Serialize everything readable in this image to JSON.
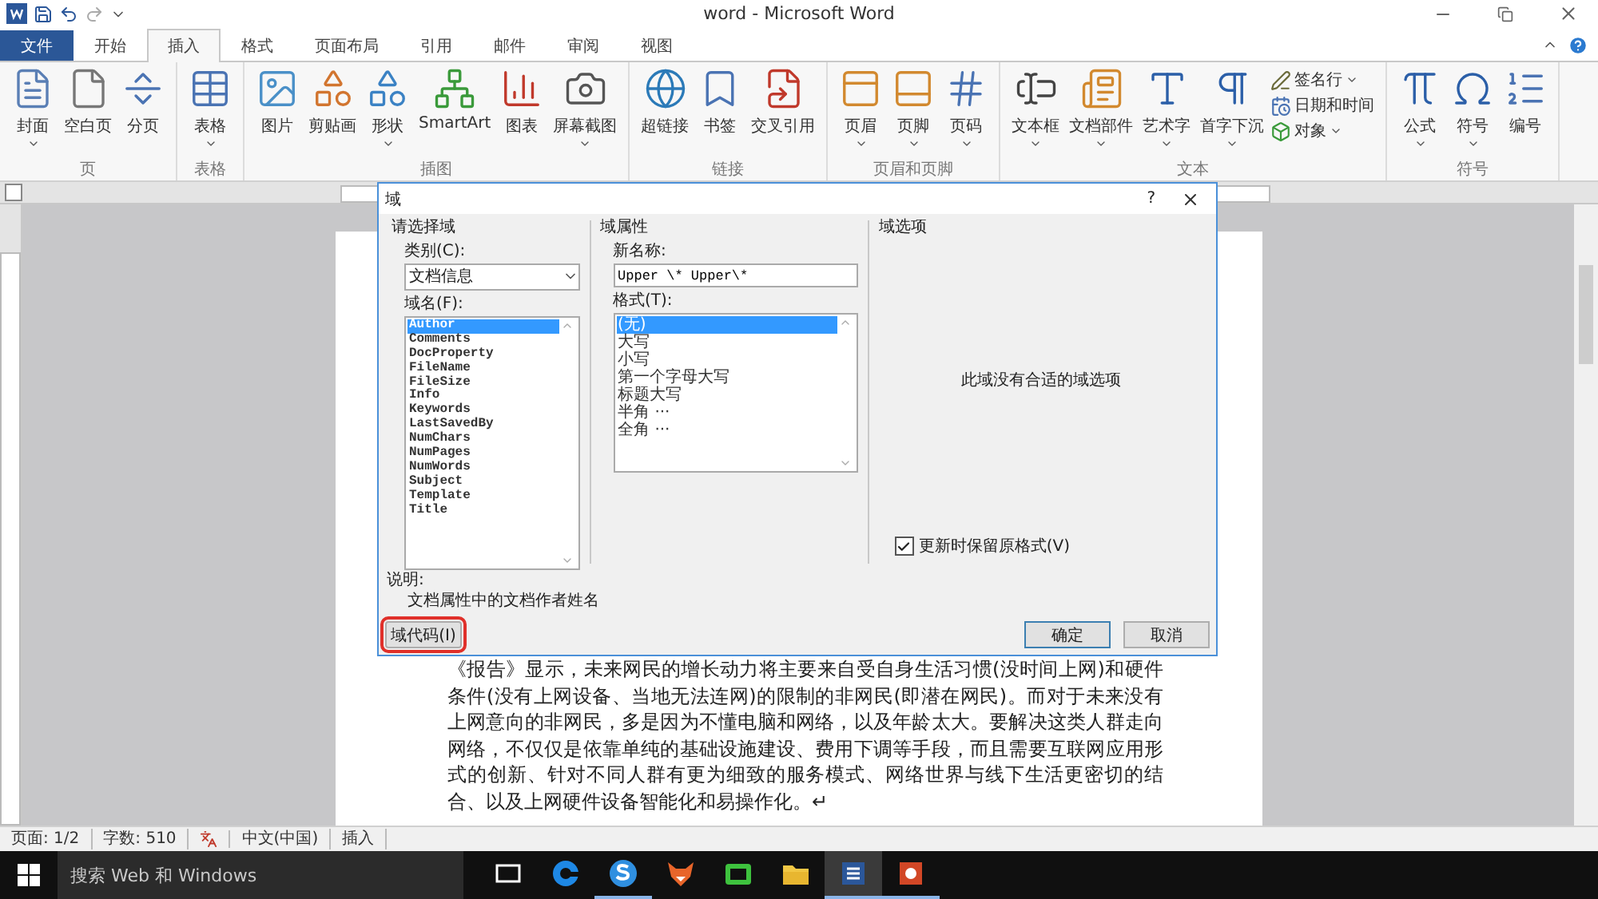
{
  "title_bar": {
    "title": "word  -  Microsoft Word"
  },
  "tabs": [
    {
      "label": "文件",
      "kind": "file",
      "selected": false
    },
    {
      "label": "开始",
      "kind": "tab",
      "selected": false
    },
    {
      "label": "插入",
      "kind": "tab",
      "selected": true
    },
    {
      "label": "格式",
      "kind": "tab",
      "selected": false
    },
    {
      "label": "页面布局",
      "kind": "tab",
      "selected": false
    },
    {
      "label": "引用",
      "kind": "tab",
      "selected": false
    },
    {
      "label": "邮件",
      "kind": "tab",
      "selected": false
    },
    {
      "label": "审阅",
      "kind": "tab",
      "selected": false
    },
    {
      "label": "视图",
      "kind": "tab",
      "selected": false
    }
  ],
  "ribbon": {
    "groups": [
      {
        "label": "页",
        "items": [
          {
            "label": "封面",
            "kind": "large",
            "dropdown": true
          },
          {
            "label": "空白页",
            "kind": "large",
            "dropdown": false
          },
          {
            "label": "分页",
            "kind": "large",
            "dropdown": false
          }
        ]
      },
      {
        "label": "表格",
        "items": [
          {
            "label": "表格",
            "kind": "large",
            "dropdown": true
          }
        ]
      },
      {
        "label": "插图",
        "items": [
          {
            "label": "图片",
            "kind": "large",
            "dropdown": false
          },
          {
            "label": "剪贴画",
            "kind": "large",
            "dropdown": false
          },
          {
            "label": "形状",
            "kind": "large",
            "dropdown": true
          },
          {
            "label": "SmartArt",
            "kind": "large",
            "dropdown": false
          },
          {
            "label": "图表",
            "kind": "large",
            "dropdown": false
          },
          {
            "label": "屏幕截图",
            "kind": "large",
            "dropdown": true
          }
        ]
      },
      {
        "label": "链接",
        "items": [
          {
            "label": "超链接",
            "kind": "large",
            "dropdown": false
          },
          {
            "label": "书签",
            "kind": "large",
            "dropdown": false
          },
          {
            "label": "交叉引用",
            "kind": "large",
            "dropdown": false
          }
        ]
      },
      {
        "label": "页眉和页脚",
        "items": [
          {
            "label": "页眉",
            "kind": "large",
            "dropdown": true
          },
          {
            "label": "页脚",
            "kind": "large",
            "dropdown": true
          },
          {
            "label": "页码",
            "kind": "large",
            "dropdown": true
          }
        ]
      },
      {
        "label": "文本",
        "items": [
          {
            "label": "文本框",
            "kind": "large",
            "dropdown": true
          },
          {
            "label": "文档部件",
            "kind": "large",
            "dropdown": true
          },
          {
            "label": "艺术字",
            "kind": "large",
            "dropdown": true
          },
          {
            "label": "首字下沉",
            "kind": "large",
            "dropdown": true
          },
          {
            "label": "签名行",
            "kind": "small",
            "dropdown": true
          },
          {
            "label": "日期和时间",
            "kind": "small",
            "dropdown": false
          },
          {
            "label": "对象",
            "kind": "small",
            "dropdown": true
          }
        ]
      },
      {
        "label": "符号",
        "items": [
          {
            "label": "公式",
            "kind": "large",
            "dropdown": true
          },
          {
            "label": "符号",
            "kind": "large",
            "dropdown": true
          },
          {
            "label": "编号",
            "kind": "large",
            "dropdown": false
          }
        ]
      }
    ]
  },
  "document": {
    "paragraph": "《报告》显示，未来网民的增长动力将主要来自受自身生活习惯(没时间上网)和硬件条件(没有上网设备、当地无法连网)的限制的非网民(即潜在网民)。而对于未来没有上网意向的非网民，多是因为不懂电脑和网络，以及年龄太大。要解决这类人群走向网络，不仅仅是依靠单纯的基础设施建设、费用下调等手段，而且需要互联网应用形式的创新、针对不同人群有更为细致的服务模式、网络世界与线下生活更密切的结合、以及上网硬件设备智能化和易操作化。↵"
  },
  "dialog": {
    "title": "域",
    "help": "?",
    "choose": {
      "heading": "请选择域",
      "category_label": "类别(C):",
      "category_value": "文档信息",
      "names_label": "域名(F):",
      "names": [
        {
          "label": "Author",
          "selected": true
        },
        {
          "label": "Comments",
          "selected": false
        },
        {
          "label": "DocProperty",
          "selected": false
        },
        {
          "label": "FileName",
          "selected": false
        },
        {
          "label": "FileSize",
          "selected": false
        },
        {
          "label": "Info",
          "selected": false
        },
        {
          "label": "Keywords",
          "selected": false
        },
        {
          "label": "LastSavedBy",
          "selected": false
        },
        {
          "label": "NumChars",
          "selected": false
        },
        {
          "label": "NumPages",
          "selected": false
        },
        {
          "label": "NumWords",
          "selected": false
        },
        {
          "label": "Subject",
          "selected": false
        },
        {
          "label": "Template",
          "selected": false
        },
        {
          "label": "Title",
          "selected": false
        }
      ]
    },
    "properties": {
      "heading": "域属性",
      "name_label": "新名称:",
      "name_value": "Upper \\* Upper\\*",
      "format_label": "格式(T):",
      "formats": [
        {
          "label": "(无)",
          "selected": true
        },
        {
          "label": "大写",
          "selected": false
        },
        {
          "label": "小写",
          "selected": false
        },
        {
          "label": "第一个字母大写",
          "selected": false
        },
        {
          "label": "标题大写",
          "selected": false
        },
        {
          "label": "半角 ···",
          "selected": false
        },
        {
          "label": "全角 ···",
          "selected": false
        }
      ]
    },
    "options": {
      "heading": "域选项",
      "message": "此域没有合适的域选项",
      "keep_format": {
        "label": "更新时保留原格式(V)",
        "checked": true
      }
    },
    "description": {
      "label": "说明:",
      "text": "文档属性中的文档作者姓名"
    },
    "buttons": [
      {
        "label": "域代码(I)",
        "kind": "field-codes",
        "highlighted": true
      },
      {
        "label": "确定",
        "kind": "ok",
        "default": true
      },
      {
        "label": "取消",
        "kind": "cancel",
        "default": false
      }
    ]
  },
  "status_bar": {
    "items": [
      {
        "kind": "text",
        "label": "页面: 1/2"
      },
      {
        "kind": "text",
        "label": "字数: 510"
      },
      {
        "kind": "icon"
      },
      {
        "kind": "text",
        "label": "中文(中国)"
      },
      {
        "kind": "text",
        "label": "插入"
      }
    ]
  },
  "taskbar": {
    "search": {
      "placeholder": "搜索 Web 和 Windows"
    },
    "apps": [
      {
        "selected": false,
        "running": false
      },
      {
        "selected": false,
        "running": false
      },
      {
        "selected": false,
        "running": true
      },
      {
        "selected": false,
        "running": false
      },
      {
        "selected": false,
        "running": false
      },
      {
        "selected": false,
        "running": false
      },
      {
        "selected": true,
        "running": true
      },
      {
        "selected": false,
        "running": true
      }
    ]
  }
}
